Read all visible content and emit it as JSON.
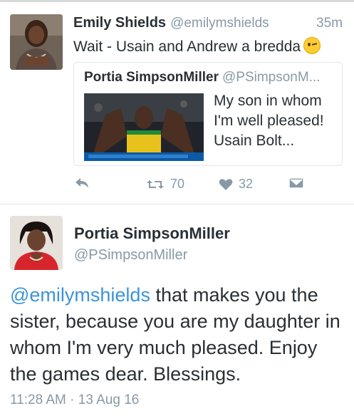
{
  "tweet_reply": {
    "author_name": "Emily Shields",
    "author_handle": "@emilymshields",
    "time_ago": "35m",
    "text": "Wait - Usain and Andrew a bredda",
    "emoji": "winking-face",
    "quoted": {
      "author_name": "Portia SimpsonMiller",
      "author_handle": "@PSimpsonM...",
      "text": "My son in whom I'm well pleased! Usain Bolt..."
    },
    "actions": {
      "reply_icon": "reply-icon",
      "retweet_icon": "retweet-icon",
      "retweet_count": "70",
      "like_icon": "heart-icon",
      "like_count": "32",
      "message_icon": "direct-message-icon"
    }
  },
  "tweet_main": {
    "author_name": "Portia SimpsonMiller",
    "author_handle": "@PSimpsonMiller",
    "mention": "@emilymshields",
    "text": " that makes you the sister, because you are my daughter in whom I'm very much pleased. Enjoy the games dear. Blessings.",
    "timestamp": "11:28 AM · 13 Aug 16"
  },
  "colors": {
    "text": "#292f33",
    "muted": "#8899a6",
    "link": "#3b94d9",
    "border": "#e1e8ed"
  }
}
